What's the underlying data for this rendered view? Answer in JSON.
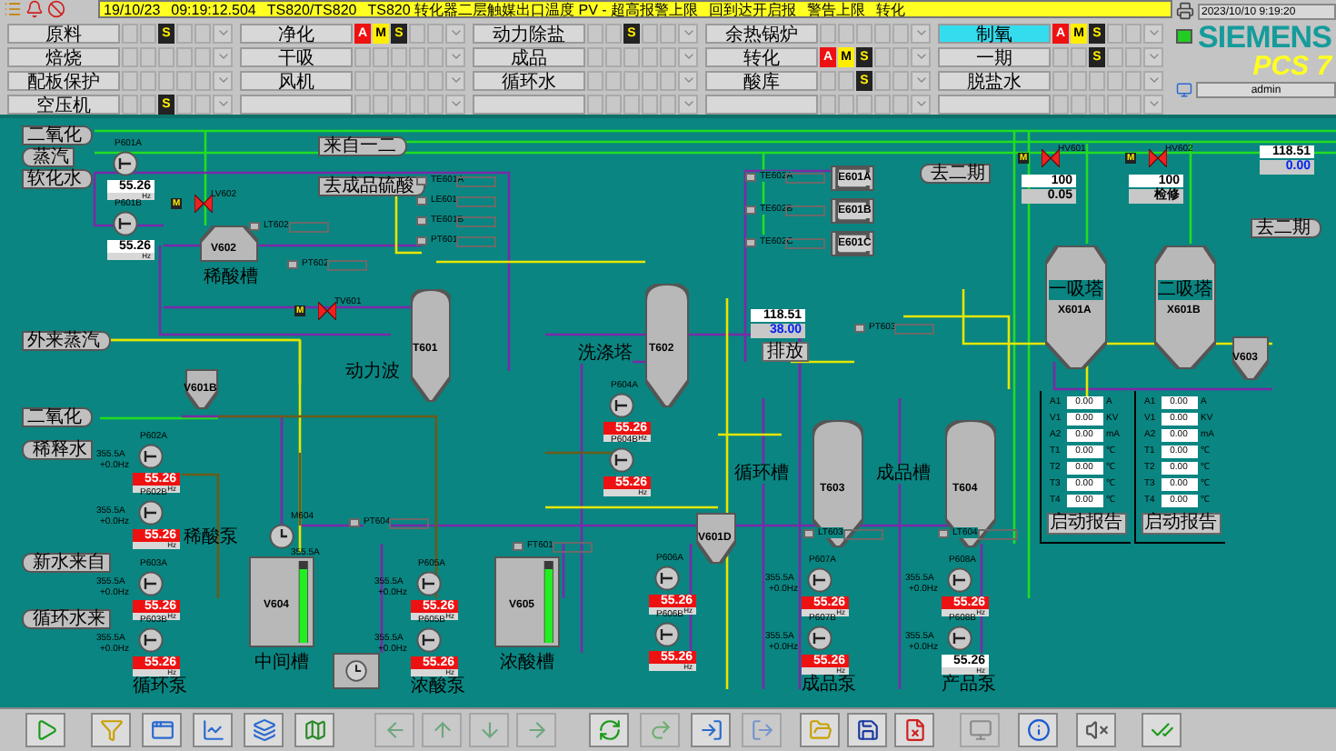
{
  "alarm_bar": {
    "date": "19/10/23",
    "time": "09:19:12.504",
    "source": "TS820/TS820",
    "message": "TS820 转化器二层触媒出口温度 PV - 超高报警上限",
    "status": "回到达开启报",
    "level": "警告上限",
    "area": "转化"
  },
  "clock": "2023/10/10 9:19:20",
  "user": "admin",
  "status_ok": true,
  "logo": {
    "brand": "SIEMENS",
    "product": "PCS 7"
  },
  "area_groups": [
    {
      "items": [
        {
          "label": "原料",
          "selected": false,
          "s": "S"
        },
        {
          "label": "焙烧",
          "selected": false
        },
        {
          "label": "配板保护",
          "selected": false
        },
        {
          "label": "空压机",
          "selected": false,
          "s": "S"
        }
      ]
    },
    {
      "items": [
        {
          "label": "净化",
          "selected": false,
          "a": "A",
          "m": "M",
          "s": "S"
        },
        {
          "label": "干吸",
          "selected": false
        },
        {
          "label": "风机",
          "selected": false
        },
        {
          "selected": false
        }
      ]
    },
    {
      "items": [
        {
          "label": "动力除盐",
          "selected": false,
          "s": "S"
        },
        {
          "label": "成品",
          "selected": false
        },
        {
          "label": "循环水",
          "selected": false
        },
        {
          "selected": false
        }
      ]
    },
    {
      "items": [
        {
          "label": "余热锅炉",
          "selected": false
        },
        {
          "label": "转化",
          "selected": false,
          "a": "A",
          "m": "M",
          "s": "S"
        },
        {
          "label": "酸库",
          "selected": false,
          "s": "S"
        },
        {
          "selected": false
        }
      ]
    },
    {
      "items": [
        {
          "label": "制氧",
          "selected": true,
          "a": "A",
          "m": "M",
          "s": "S"
        },
        {
          "label": "一期",
          "selected": false,
          "s": "S"
        },
        {
          "label": "脱盐水",
          "selected": false
        },
        {
          "selected": false
        }
      ]
    }
  ],
  "inlets": [
    {
      "label": "二氧化",
      "kind": "outlet"
    },
    {
      "label": "蒸汽",
      "kind": "inlet"
    },
    {
      "label": "软化水",
      "kind": "outlet"
    },
    {
      "label": "来自一二",
      "kind": "outlet"
    },
    {
      "label": "去成品硫酸",
      "kind": "outlet"
    },
    {
      "label": "外来蒸汽",
      "kind": "outlet"
    },
    {
      "label": "二氧化",
      "kind": "outlet"
    },
    {
      "label": "稀释水",
      "kind": "inlet"
    },
    {
      "label": "新水来自",
      "kind": "inlet"
    },
    {
      "label": "循环水来",
      "kind": "inlet"
    },
    {
      "label": "去二期",
      "kind": "inlet"
    },
    {
      "label": "去二期",
      "kind": "outlet"
    }
  ],
  "vessels": [
    {
      "kind": "dome",
      "label": "V602",
      "caption": "稀酸槽"
    },
    {
      "kind": "tower",
      "label": "T601",
      "caption": "动力波"
    },
    {
      "kind": "tower",
      "label": "T602",
      "caption": "洗涤塔"
    },
    {
      "kind": "hopper",
      "label": "V601B"
    },
    {
      "kind": "tower",
      "label": "T603",
      "caption": "循环槽"
    },
    {
      "kind": "tower",
      "label": "T604",
      "caption": "成品槽"
    },
    {
      "kind": "hopper",
      "label": "V601D"
    },
    {
      "kind": "open_tank",
      "label": "V604",
      "caption": "中间槽",
      "level": 0.9
    },
    {
      "kind": "open_tank",
      "label": "V605",
      "caption": "浓酸槽",
      "level": 0.9
    },
    {
      "kind": "reactor",
      "label": "X601A",
      "caption": "一吸塔"
    },
    {
      "kind": "reactor",
      "label": "X601B",
      "caption": "二吸塔"
    },
    {
      "kind": "hopper",
      "label": "V603"
    },
    {
      "kind": "exchanger",
      "label": "E601A"
    },
    {
      "kind": "exchanger",
      "label": "E601B"
    },
    {
      "kind": "exchanger",
      "label": "E601C"
    }
  ],
  "valves": [
    {
      "tag": "LV602",
      "mode": "M"
    },
    {
      "tag": "TV601",
      "mode": "M"
    },
    {
      "tag": "HV601",
      "mode": "M"
    },
    {
      "tag": "HV602",
      "mode": "M"
    }
  ],
  "readouts": [
    {
      "value": "118.51",
      "setpoint": "38.00",
      "note": "排放"
    },
    {
      "value": "118.51",
      "setpoint": "0.00"
    },
    {
      "value": "100",
      "setpoint": "0.05"
    },
    {
      "value": "100",
      "setpoint": "检修"
    }
  ],
  "tags": [
    "TE601A",
    "LE601",
    "TE601B",
    "PT601",
    "PT602",
    "LT602",
    "TE602A",
    "TE602B",
    "TE602C",
    "PT603",
    "LT603",
    "LT604",
    "FT601",
    "PT604"
  ],
  "pumps": [
    {
      "tag": "P601A",
      "value": "55.26",
      "unit": "Hz",
      "alarm": false
    },
    {
      "tag": "P601B",
      "value": "55.26",
      "unit": "Hz",
      "alarm": false
    },
    {
      "tag": "P602A",
      "value": "55.26",
      "unit": "Hz",
      "current": "355.5A",
      "freq": "+0.0Hz",
      "alarm": true
    },
    {
      "tag": "P602B",
      "value": "55.26",
      "unit": "Hz",
      "current": "355.5A",
      "freq": "+0.0Hz",
      "alarm": true,
      "caption": "稀酸泵"
    },
    {
      "tag": "P603A",
      "value": "55.26",
      "unit": "Hz",
      "current": "355.5A",
      "freq": "+0.0Hz",
      "alarm": true
    },
    {
      "tag": "P603B",
      "value": "55.26",
      "unit": "Hz",
      "current": "355.5A",
      "freq": "+0.0Hz",
      "alarm": true,
      "caption": "循环泵"
    },
    {
      "tag": "P604A",
      "value": "55.26",
      "unit": "Hz",
      "alarm": true
    },
    {
      "tag": "P604B",
      "value": "55.26",
      "unit": "Hz",
      "alarm": true
    },
    {
      "tag": "P605A",
      "value": "55.26",
      "unit": "Hz",
      "current": "355.5A",
      "freq": "+0.0Hz",
      "alarm": true
    },
    {
      "tag": "P605B",
      "value": "55.26",
      "unit": "Hz",
      "current": "355.5A",
      "freq": "+0.0Hz",
      "alarm": true,
      "caption": "浓酸泵"
    },
    {
      "tag": "P606A",
      "value": "55.26",
      "unit": "Hz",
      "alarm": true
    },
    {
      "tag": "P606B",
      "value": "55.26",
      "unit": "Hz",
      "alarm": true
    },
    {
      "tag": "P607A",
      "value": "55.26",
      "unit": "Hz",
      "current": "355.5A",
      "freq": "+0.0Hz",
      "alarm": true
    },
    {
      "tag": "P607B",
      "value": "55.26",
      "unit": "Hz",
      "current": "355.5A",
      "freq": "+0.0Hz",
      "alarm": true,
      "caption": "成品泵"
    },
    {
      "tag": "P608A",
      "value": "55.26",
      "unit": "Hz",
      "current": "355.5A",
      "freq": "+0.0Hz",
      "alarm": true
    },
    {
      "tag": "P608B",
      "value": "55.26",
      "unit": "Hz",
      "current": "355.5A",
      "freq": "+0.0Hz",
      "alarm": false,
      "caption": "产品泵"
    }
  ],
  "agitator": {
    "tag": "M604",
    "current": "355.5A"
  },
  "power_panels": [
    {
      "rows": [
        {
          "label": "A1",
          "value": "0.00",
          "unit": "A"
        },
        {
          "label": "V1",
          "value": "0.00",
          "unit": "KV"
        },
        {
          "label": "A2",
          "value": "0.00",
          "unit": "mA"
        },
        {
          "label": "T1",
          "value": "0.00",
          "unit": "℃"
        },
        {
          "label": "T2",
          "value": "0.00",
          "unit": "℃"
        },
        {
          "label": "T3",
          "value": "0.00",
          "unit": "℃"
        },
        {
          "label": "T4",
          "value": "0.00",
          "unit": "℃"
        }
      ],
      "button": "启动报告"
    },
    {
      "rows": [
        {
          "label": "A1",
          "value": "0.00",
          "unit": "A"
        },
        {
          "label": "V1",
          "value": "0.00",
          "unit": "KV"
        },
        {
          "label": "A2",
          "value": "0.00",
          "unit": "mA"
        },
        {
          "label": "T1",
          "value": "0.00",
          "unit": "℃"
        },
        {
          "label": "T2",
          "value": "0.00",
          "unit": "℃"
        },
        {
          "label": "T3",
          "value": "0.00",
          "unit": "℃"
        },
        {
          "label": "T4",
          "value": "0.00",
          "unit": "℃"
        }
      ],
      "button": "启动报告"
    }
  ],
  "toolbar": [
    {
      "kind": "play",
      "disabled": false
    },
    {
      "kind": "filter",
      "disabled": false
    },
    {
      "kind": "window",
      "disabled": false
    },
    {
      "kind": "chart",
      "disabled": false
    },
    {
      "kind": "layers",
      "disabled": false
    },
    {
      "kind": "map",
      "disabled": false
    },
    {
      "kind": "left",
      "disabled": true
    },
    {
      "kind": "up",
      "disabled": true
    },
    {
      "kind": "down",
      "disabled": true
    },
    {
      "kind": "right",
      "disabled": true
    },
    {
      "kind": "refresh",
      "disabled": false
    },
    {
      "kind": "redo",
      "disabled": true
    },
    {
      "kind": "import",
      "disabled": false
    },
    {
      "kind": "export",
      "disabled": true
    },
    {
      "kind": "open",
      "disabled": false
    },
    {
      "kind": "save",
      "disabled": false
    },
    {
      "kind": "delete",
      "disabled": false
    },
    {
      "kind": "monitor",
      "disabled": true
    },
    {
      "kind": "info",
      "disabled": false
    },
    {
      "kind": "mute",
      "disabled": false
    },
    {
      "kind": "ack",
      "disabled": false
    }
  ]
}
